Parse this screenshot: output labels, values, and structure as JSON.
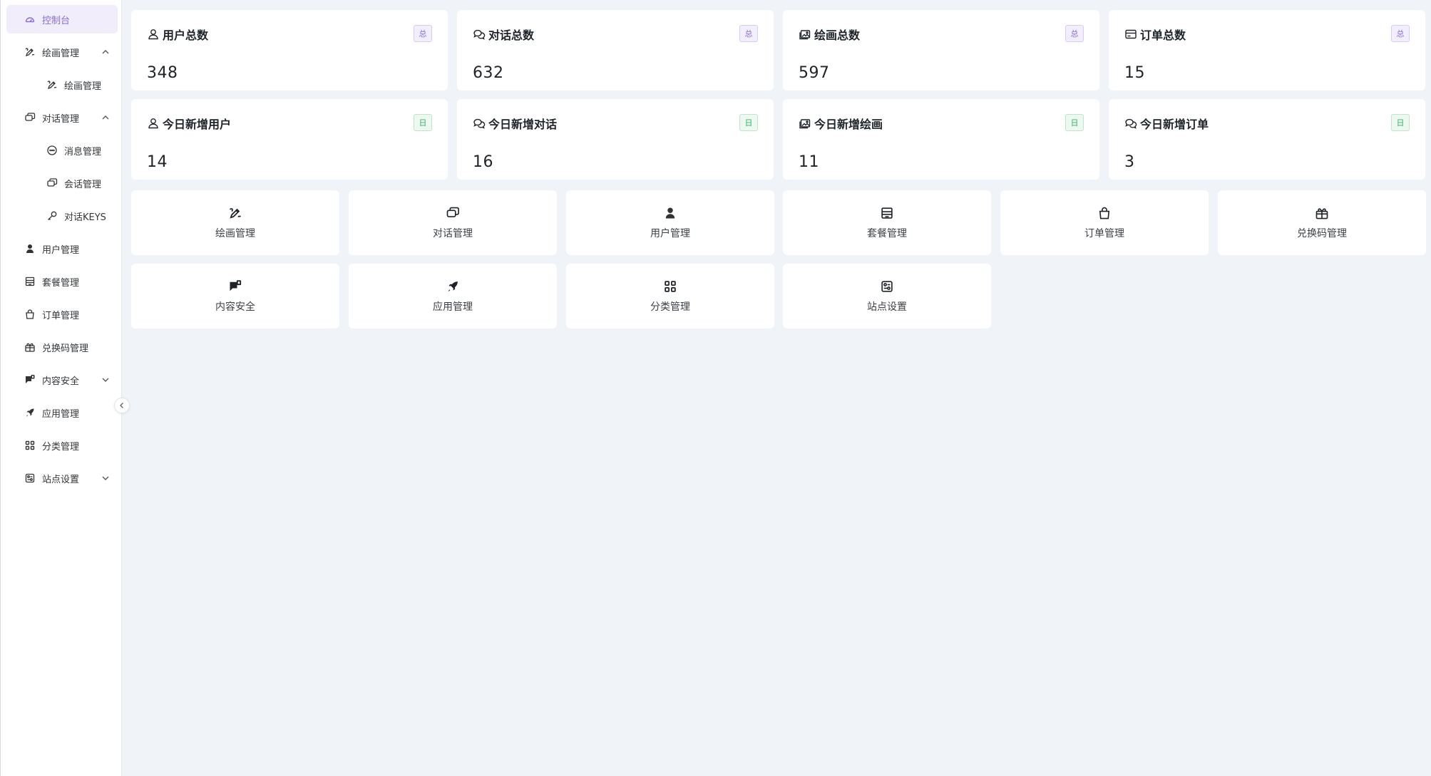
{
  "sidebar": {
    "items": [
      {
        "label": "控制台",
        "icon": "dashboard-icon",
        "active": true
      },
      {
        "label": "绘画管理",
        "icon": "draw-icon",
        "expanded": true
      },
      {
        "label": "绘画管理",
        "icon": "draw-icon",
        "sub": true
      },
      {
        "label": "对话管理",
        "icon": "chat-icon",
        "expanded": true
      },
      {
        "label": "消息管理",
        "icon": "message-icon",
        "sub": true
      },
      {
        "label": "会话管理",
        "icon": "chat-icon",
        "sub": true
      },
      {
        "label": "对话KEYS",
        "icon": "key-icon",
        "sub": true
      },
      {
        "label": "用户管理",
        "icon": "user-icon"
      },
      {
        "label": "套餐管理",
        "icon": "store-icon"
      },
      {
        "label": "订单管理",
        "icon": "bag-icon"
      },
      {
        "label": "兑换码管理",
        "icon": "gift-icon"
      },
      {
        "label": "内容安全",
        "icon": "shield-chat-icon",
        "expanded": false
      },
      {
        "label": "应用管理",
        "icon": "rocket-icon"
      },
      {
        "label": "分类管理",
        "icon": "grid-icon"
      },
      {
        "label": "站点设置",
        "icon": "settings-panel-icon",
        "expanded": false
      }
    ]
  },
  "stats": {
    "total": [
      {
        "title": "用户总数",
        "value": "348",
        "badge": "总",
        "icon": "user-outline-icon"
      },
      {
        "title": "对话总数",
        "value": "632",
        "badge": "总",
        "icon": "chat-bubbles-icon"
      },
      {
        "title": "绘画总数",
        "value": "597",
        "badge": "总",
        "icon": "image-icon"
      },
      {
        "title": "订单总数",
        "value": "15",
        "badge": "总",
        "icon": "card-icon"
      }
    ],
    "today": [
      {
        "title": "今日新增用户",
        "value": "14",
        "badge": "日",
        "icon": "user-outline-icon"
      },
      {
        "title": "今日新增对话",
        "value": "16",
        "badge": "日",
        "icon": "chat-bubbles-icon"
      },
      {
        "title": "今日新增绘画",
        "value": "11",
        "badge": "日",
        "icon": "image-icon"
      },
      {
        "title": "今日新增订单",
        "value": "3",
        "badge": "日",
        "icon": "chat-bubbles-icon"
      }
    ]
  },
  "shortcuts": [
    {
      "label": "绘画管理",
      "icon": "draw-icon"
    },
    {
      "label": "对话管理",
      "icon": "chat-icon"
    },
    {
      "label": "用户管理",
      "icon": "user-icon"
    },
    {
      "label": "套餐管理",
      "icon": "store-icon"
    },
    {
      "label": "订单管理",
      "icon": "bag-icon"
    },
    {
      "label": "兑换码管理",
      "icon": "gift-icon"
    },
    {
      "label": "内容安全",
      "icon": "shield-chat-icon"
    },
    {
      "label": "应用管理",
      "icon": "rocket-icon"
    },
    {
      "label": "分类管理",
      "icon": "grid-icon"
    },
    {
      "label": "站点设置",
      "icon": "settings-panel-icon"
    }
  ],
  "colors": {
    "accent": "#8a6ce0",
    "accent_bg": "#f1edfb",
    "day_badge": "#36b36a",
    "page_bg": "#f0f3f8",
    "card_bg": "#ffffff"
  }
}
